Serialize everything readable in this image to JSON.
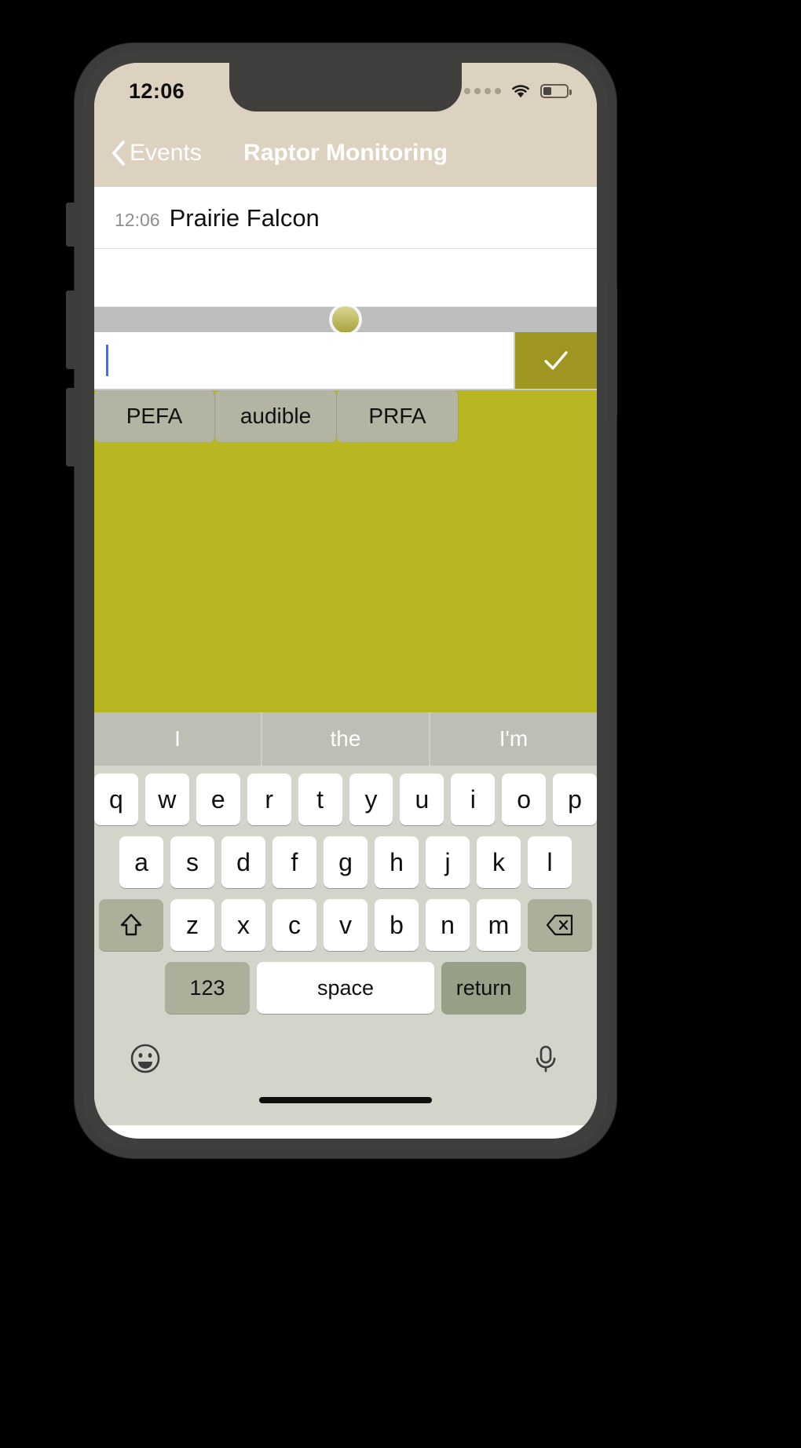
{
  "status_bar": {
    "time": "12:06",
    "signal_icon": "signal-dots-icon",
    "wifi_icon": "wifi-icon",
    "battery_icon": "battery-low-icon"
  },
  "nav_bar": {
    "back_icon": "chevron-left-icon",
    "back_label": "Events",
    "title": "Raptor Monitoring"
  },
  "notes": {
    "rows": [
      {
        "time": "12:06",
        "text": "Prairie Falcon"
      },
      {
        "time": "",
        "text": ""
      }
    ]
  },
  "drag_handle": {
    "knob_icon": "drag-knob-icon"
  },
  "entry": {
    "value": "",
    "placeholder": "",
    "accept_icon": "checkmark-icon"
  },
  "autocomplete": {
    "chips": [
      "PEFA",
      "audible",
      "PRFA"
    ]
  },
  "keyboard": {
    "predictions": [
      "I",
      "the",
      "I'm"
    ],
    "row1": [
      "q",
      "w",
      "e",
      "r",
      "t",
      "y",
      "u",
      "i",
      "o",
      "p"
    ],
    "row2": [
      "a",
      "s",
      "d",
      "f",
      "g",
      "h",
      "j",
      "k",
      "l"
    ],
    "row3": [
      "z",
      "x",
      "c",
      "v",
      "b",
      "n",
      "m"
    ],
    "shift_icon": "shift-arrow-icon",
    "backspace_icon": "backspace-icon",
    "numbers_label": "123",
    "space_label": "space",
    "return_label": "return",
    "emoji_icon": "emoji-smiley-icon",
    "mic_icon": "microphone-icon"
  },
  "theme": {
    "nav_background": "#ddd2c0",
    "accent_olive": "#b8b621",
    "accept_button": "#9e9620",
    "chip_background": "#b3b5a2",
    "keyboard_background": "#d2d5c9",
    "function_key": "#aab09a",
    "return_key": "#95a086",
    "caret": "#3b6ef5"
  }
}
